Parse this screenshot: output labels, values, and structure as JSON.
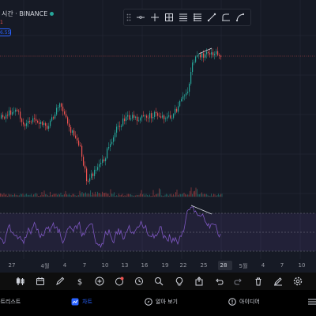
{
  "header": {
    "title": "시간 · BINANCE",
    "sub_value": "1",
    "price_tag": "6.55"
  },
  "drawing_toolbar": {
    "tools": [
      "drag-handle",
      "horizontal-line",
      "cross-hair",
      "fib-retracement",
      "text-tool",
      "parallel-channel",
      "trend-line",
      "brush",
      "curve"
    ]
  },
  "x_axis": {
    "labels": [
      "27",
      "4월",
      "4",
      "7",
      "10",
      "13",
      "16",
      "19",
      "22",
      "25",
      "28",
      "5월",
      "4",
      "7",
      "10"
    ],
    "highlighted": "28"
  },
  "bottom_toolbar": {
    "icons": [
      "indicator",
      "calendar",
      "pen",
      "dollar",
      "plus",
      "star-badge",
      "alert-clock",
      "search",
      "bulb",
      "upload",
      "undo",
      "redo",
      "trash",
      "pencil",
      "settings"
    ]
  },
  "tabs": [
    {
      "label": "차트리스트",
      "icon": "list",
      "active": false
    },
    {
      "label": "차트",
      "icon": "chart",
      "active": true
    },
    {
      "label": "알아 보기",
      "icon": "compass",
      "active": false
    },
    {
      "label": "아이디어",
      "icon": "idea",
      "active": false
    },
    {
      "label": "",
      "icon": "menu",
      "active": false
    }
  ],
  "colors": {
    "up": "#26a69a",
    "down": "#ef5350",
    "rsi": "#7e57c2",
    "accent": "#2962ff",
    "background": "#161a25"
  }
}
